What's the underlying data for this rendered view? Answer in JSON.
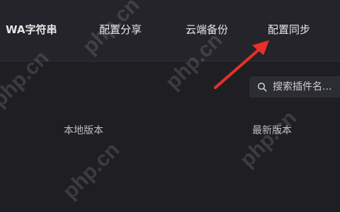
{
  "topbar": {
    "tabs": [
      {
        "label": "WA字符串"
      },
      {
        "label": "配置分享"
      },
      {
        "label": "云端备份"
      },
      {
        "label": "配置同步"
      }
    ]
  },
  "search": {
    "placeholder": "搜索插件名...",
    "icon": "search-icon"
  },
  "columns": {
    "local_version": "本地版本",
    "latest_version": "最新版本"
  },
  "watermark": {
    "text": "php.cn"
  },
  "colors": {
    "background": "#1f1f23",
    "topbar": "#24242a",
    "arrow": "#e8302a"
  }
}
